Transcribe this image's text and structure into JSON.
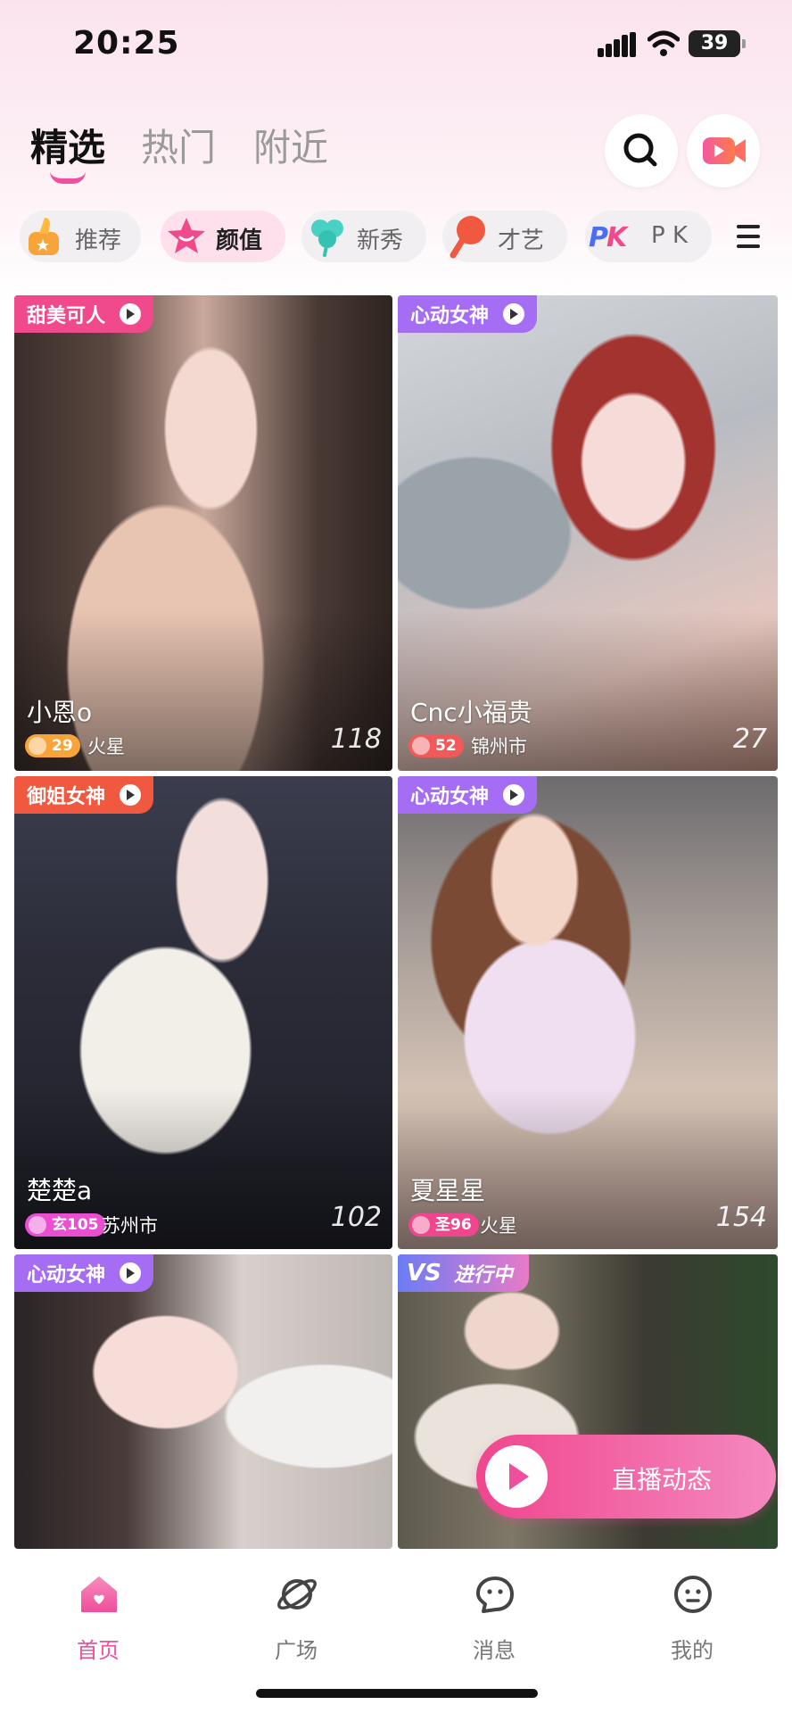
{
  "status_bar": {
    "time": "20:25",
    "battery": "39"
  },
  "top_tabs": [
    {
      "label": "精选",
      "active": true
    },
    {
      "label": "热门",
      "active": false
    },
    {
      "label": "附近",
      "active": false
    }
  ],
  "header_icons": [
    "search-icon",
    "video-camera-icon"
  ],
  "categories": [
    {
      "label": "推荐",
      "icon": "thumbs-up-icon",
      "active": false
    },
    {
      "label": "颜值",
      "icon": "star-icon",
      "active": true
    },
    {
      "label": "新秀",
      "icon": "clover-icon",
      "active": false
    },
    {
      "label": "才艺",
      "icon": "microphone-icon",
      "active": false
    },
    {
      "label": "P K",
      "icon": "pk-icon",
      "active": false
    }
  ],
  "cards": [
    {
      "tag": "甜美可人",
      "tag_color": "#f04a8c",
      "name": "小恩o",
      "level": "29",
      "level_color": "#f7a53a",
      "city": "火星",
      "viewers": "118"
    },
    {
      "tag": "心动女神",
      "tag_color": "#a56cf4",
      "name": "Cnc小福贵",
      "level": "52",
      "level_color": "#f05a5a",
      "city": "锦州市",
      "viewers": "27"
    },
    {
      "tag": "御姐女神",
      "tag_color": "#f0583f",
      "name": "楚楚a",
      "level": "玄105",
      "level_color": "#e94fd0",
      "city": "苏州市",
      "viewers": "102"
    },
    {
      "tag": "心动女神",
      "tag_color": "#a56cf4",
      "name": "夏星星",
      "level": "圣96",
      "level_color": "#f0468d",
      "city": "火星",
      "viewers": "154"
    },
    {
      "tag": "心动女神",
      "tag_color": "#a56cf4",
      "name": "",
      "level": "",
      "city": "",
      "viewers": ""
    },
    {
      "tag": "进行中",
      "tag_prefix": "VS",
      "tag_color": "#c46ef0",
      "name": "",
      "level": "",
      "city": "",
      "viewers": ""
    }
  ],
  "live_button": {
    "label": "直播动态"
  },
  "bottom_nav": [
    {
      "label": "首页",
      "icon": "home-icon",
      "active": true
    },
    {
      "label": "广场",
      "icon": "planet-icon",
      "active": false
    },
    {
      "label": "消息",
      "icon": "message-icon",
      "active": false
    },
    {
      "label": "我的",
      "icon": "profile-face-icon",
      "active": false
    }
  ],
  "colors": {
    "accent": "#ef4f9c",
    "active_pill_bg": "#fde0ec"
  }
}
